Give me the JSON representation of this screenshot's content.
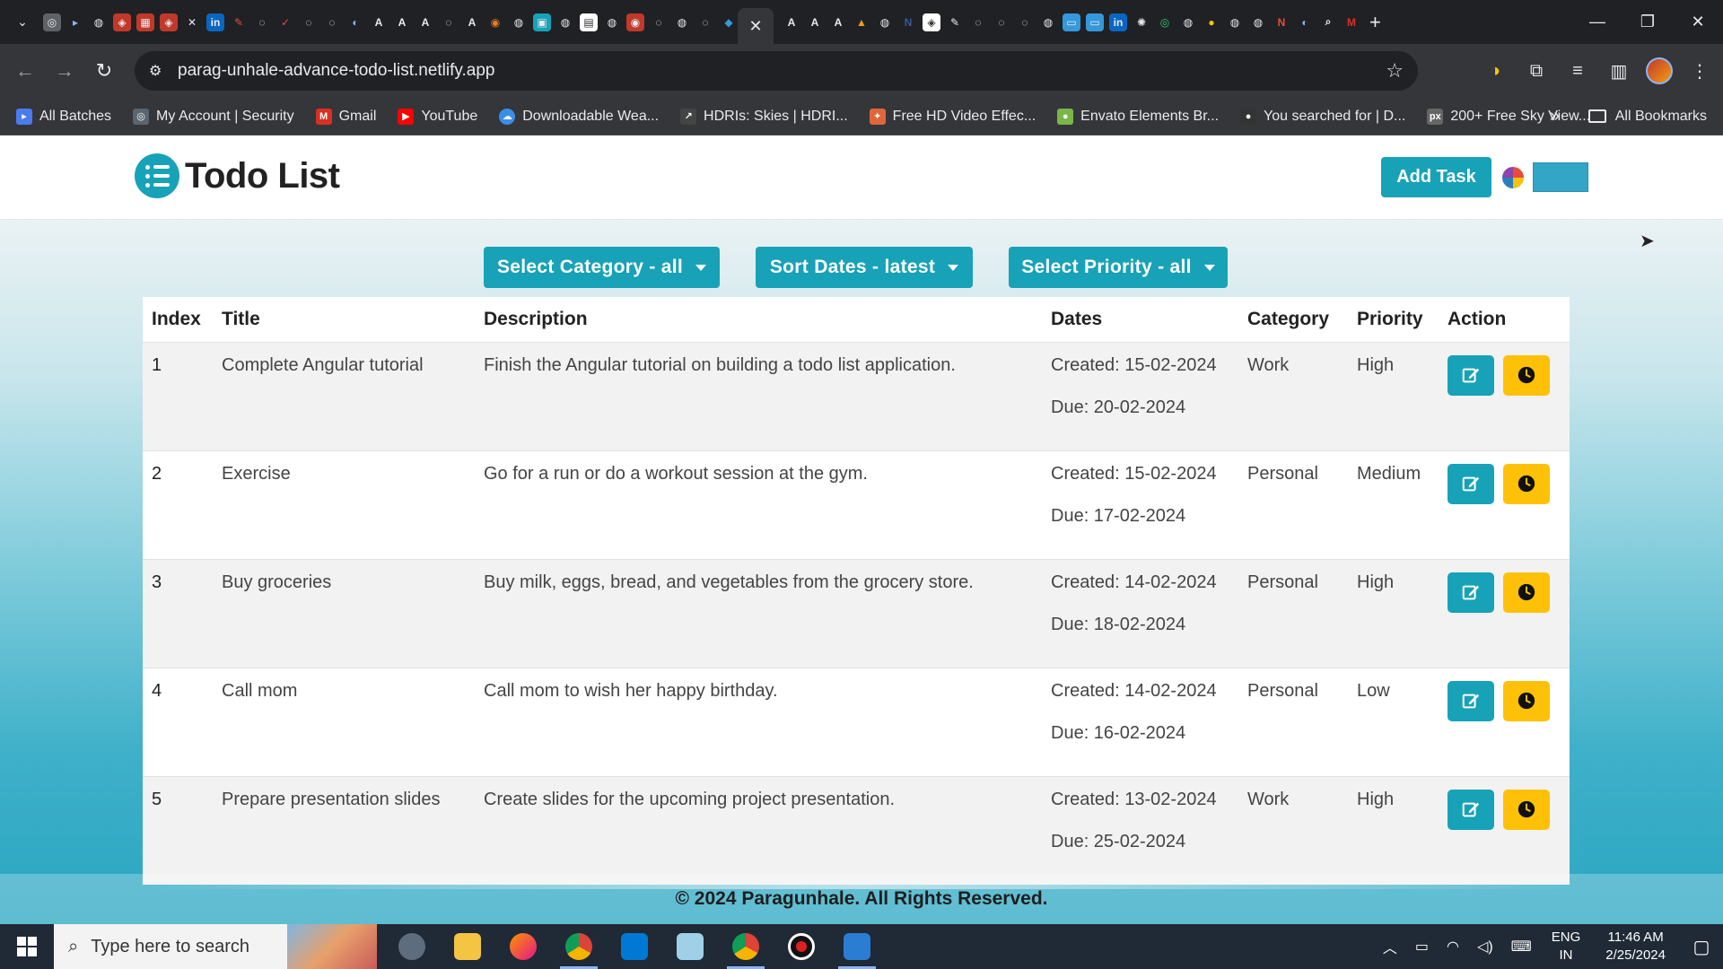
{
  "browser": {
    "url": "parag-unhale-advance-todo-list.netlify.app",
    "tab_icons": [
      "A",
      "A",
      "A",
      "A",
      "A",
      "A",
      "A"
    ],
    "bookmarks": [
      {
        "label": "All Batches",
        "icon": "arrow-icon",
        "color": "#4a7cf0"
      },
      {
        "label": "My Account | Security",
        "icon": "account-icon",
        "color": "#5a6570"
      },
      {
        "label": "Gmail",
        "icon": "gmail-icon",
        "color": "#d93025"
      },
      {
        "label": "YouTube",
        "icon": "youtube-icon",
        "color": "#ff0000"
      },
      {
        "label": "Downloadable Wea...",
        "icon": "weather-icon",
        "color": "#3a8ee6"
      },
      {
        "label": "HDRIs: Skies | HDRI...",
        "icon": "hdri-icon",
        "color": "#444"
      },
      {
        "label": "Free HD Video Effec...",
        "icon": "video-icon",
        "color": "#e0663a"
      },
      {
        "label": "Envato Elements Br...",
        "icon": "envato-icon",
        "color": "#7ab648"
      },
      {
        "label": "You searched for | D...",
        "icon": "search-bookmark-icon",
        "color": "#333"
      },
      {
        "label": "200+ Free Sky View...",
        "icon": "px-icon",
        "color": "#666"
      }
    ],
    "more_label": "»",
    "all_bookmarks": "All Bookmarks"
  },
  "app": {
    "title": "Todo List",
    "add_task": "Add Task",
    "filters": {
      "category": "Select Category - all",
      "dates": "Sort Dates - latest",
      "priority": "Select Priority - all"
    },
    "table": {
      "headers": [
        "Index",
        "Title",
        "Description",
        "Dates",
        "Category",
        "Priority",
        "Action"
      ],
      "rows": [
        {
          "index": "1",
          "title": "Complete Angular tutorial",
          "description": "Finish the Angular tutorial on building a todo list application.",
          "created": "Created: 15-02-2024",
          "due": "Due: 20-02-2024",
          "category": "Work",
          "priority": "High"
        },
        {
          "index": "2",
          "title": "Exercise",
          "description": "Go for a run or do a workout session at the gym.",
          "created": "Created: 15-02-2024",
          "due": "Due: 17-02-2024",
          "category": "Personal",
          "priority": "Medium"
        },
        {
          "index": "3",
          "title": "Buy groceries",
          "description": "Buy milk, eggs, bread, and vegetables from the grocery store.",
          "created": "Created: 14-02-2024",
          "due": "Due: 18-02-2024",
          "category": "Personal",
          "priority": "High"
        },
        {
          "index": "4",
          "title": "Call mom",
          "description": "Call mom to wish her happy birthday.",
          "created": "Created: 14-02-2024",
          "due": "Due: 16-02-2024",
          "category": "Personal",
          "priority": "Low"
        },
        {
          "index": "5",
          "title": "Prepare presentation slides",
          "description": "Create slides for the upcoming project presentation.",
          "created": "Created: 13-02-2024",
          "due": "Due: 25-02-2024",
          "category": "Work",
          "priority": "High"
        }
      ]
    },
    "footer": "© 2024 Paragunhale. All Rights Reserved.",
    "colors": {
      "primary": "#17a2b8",
      "warning": "#ffc107",
      "swatch": "#33a6c8"
    }
  },
  "taskbar": {
    "search_placeholder": "Type here to search",
    "lang_top": "ENG",
    "lang_bottom": "IN",
    "time": "11:46 AM",
    "date": "2/25/2024"
  }
}
